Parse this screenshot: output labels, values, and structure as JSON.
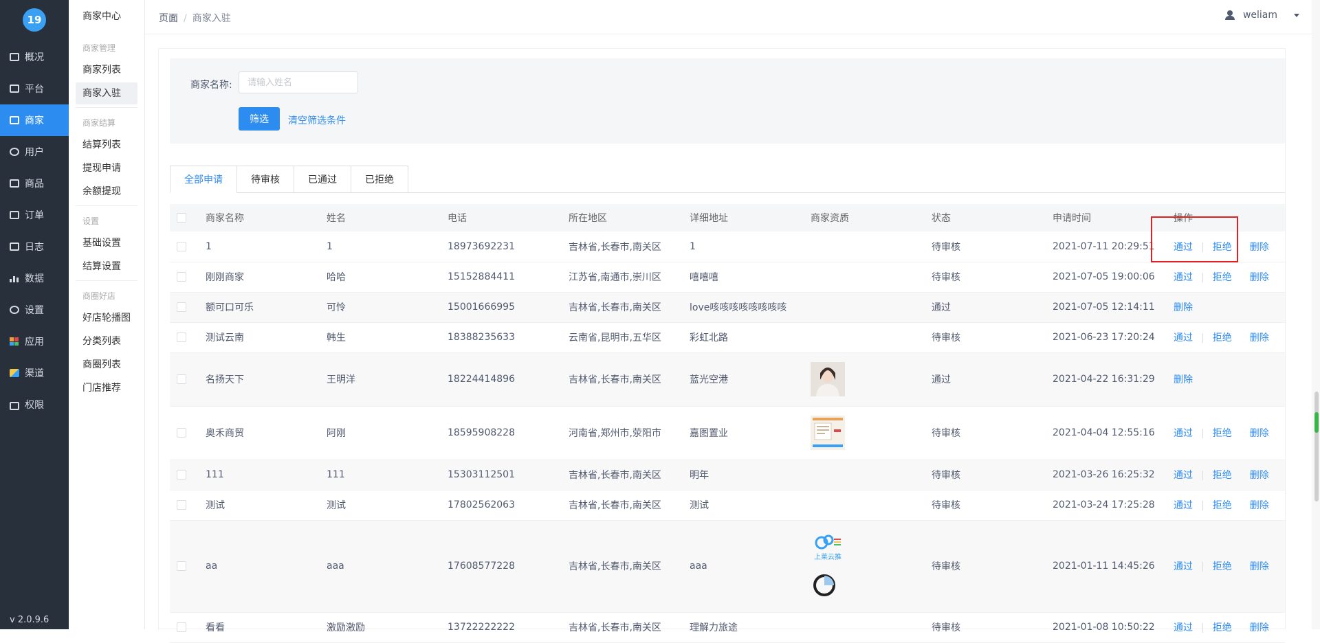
{
  "nav": {
    "logo_text": "19",
    "items": [
      {
        "label": "概况"
      },
      {
        "label": "平台"
      },
      {
        "label": "商家"
      },
      {
        "label": "用户"
      },
      {
        "label": "商品"
      },
      {
        "label": "订单"
      },
      {
        "label": "日志"
      },
      {
        "label": "数据"
      },
      {
        "label": "设置"
      },
      {
        "label": "应用"
      },
      {
        "label": "渠道"
      },
      {
        "label": "权限"
      }
    ],
    "active_index": 2,
    "version": "v 2.0.9.6",
    "accent": "#2d8cf0"
  },
  "submenu": {
    "title": "商家中心",
    "groups": [
      {
        "title": "商家管理",
        "links": [
          "商家列表",
          "商家入驻"
        ]
      },
      {
        "title": "商家结算",
        "links": [
          "结算列表",
          "提现申请",
          "余额提现"
        ]
      },
      {
        "title": "设置",
        "links": [
          "基础设置",
          "结算设置"
        ]
      },
      {
        "title": "商圈好店",
        "links": [
          "好店轮播图",
          "分类列表",
          "商圈列表",
          "门店推荐"
        ]
      }
    ]
  },
  "breadcrumb": {
    "root": "页面",
    "separator": "/",
    "current": "商家入驻"
  },
  "user": {
    "name": "weliam"
  },
  "filter": {
    "label": "商家名称:",
    "placeholder": "请输入姓名",
    "value": "",
    "submit": "筛选",
    "clear": "清空筛选条件"
  },
  "tabs": [
    "全部申请",
    "待审核",
    "已通过",
    "已拒绝"
  ],
  "table": {
    "columns": [
      "商家名称",
      "姓名",
      "电话",
      "所在地区",
      "详细地址",
      "商家资质",
      "状态",
      "申请时间",
      "操作"
    ],
    "actions": {
      "approve": "通过",
      "reject": "拒绝",
      "delete": "删除",
      "separator": "|"
    },
    "rows": [
      {
        "name": "1",
        "contact": "1",
        "phone": "18973692231",
        "region": "吉林省,长春市,南关区",
        "address": "1",
        "qual": "",
        "status": "待审核",
        "time": "2021-07-11 20:29:51"
      },
      {
        "name": "刚刚商家",
        "contact": "哈哈",
        "phone": "15152884411",
        "region": "江苏省,南通市,崇川区",
        "address": "嘻嘻嘻",
        "qual": "",
        "status": "待审核",
        "time": "2021-07-05 19:00:06"
      },
      {
        "name": "额可口可乐",
        "contact": "可怜",
        "phone": "15001666995",
        "region": "吉林省,长春市,南关区",
        "address": "love咳咳咳咳咳咳咳咳",
        "qual": "",
        "status": "通过",
        "time": "2021-07-05 12:14:11"
      },
      {
        "name": "测试云南",
        "contact": "韩生",
        "phone": "18388235633",
        "region": "云南省,昆明市,五华区",
        "address": "彩虹北路",
        "qual": "",
        "status": "待审核",
        "time": "2021-06-23 17:20:24"
      },
      {
        "name": "名扬天下",
        "contact": "王明洋",
        "phone": "18224414896",
        "region": "吉林省,长春市,南关区",
        "address": "蓝光空港",
        "qual": "portrait",
        "status": "通过",
        "time": "2021-04-22 16:31:29"
      },
      {
        "name": "奥禾商贸",
        "contact": "阿刚",
        "phone": "18595908228",
        "region": "河南省,郑州市,荥阳市",
        "address": "嘉图置业",
        "qual": "document",
        "status": "待审核",
        "time": "2021-04-04 12:55:16"
      },
      {
        "name": "111",
        "contact": "111",
        "phone": "15303112501",
        "region": "吉林省,长春市,南关区",
        "address": "明年",
        "qual": "",
        "status": "待审核",
        "time": "2021-03-26 16:25:32"
      },
      {
        "name": "测试",
        "contact": "测试",
        "phone": "17802562063",
        "region": "吉林省,长春市,南关区",
        "address": "测试",
        "qual": "",
        "status": "待审核",
        "time": "2021-03-24 17:25:28"
      },
      {
        "name": "aa",
        "contact": "aaa",
        "phone": "17608577228",
        "region": "吉林省,长春市,南关区",
        "address": "aaa",
        "qual": "logos",
        "status": "待审核",
        "time": "2021-01-11 14:45:26"
      },
      {
        "name": "看看",
        "contact": "激励激励",
        "phone": "13722222222",
        "region": "吉林省,长春市,南关区",
        "address": "理解力旅途",
        "qual": "",
        "status": "待审核",
        "time": "2021-01-08 10:50:22"
      }
    ]
  },
  "qual_logo_text": "上莱云推"
}
